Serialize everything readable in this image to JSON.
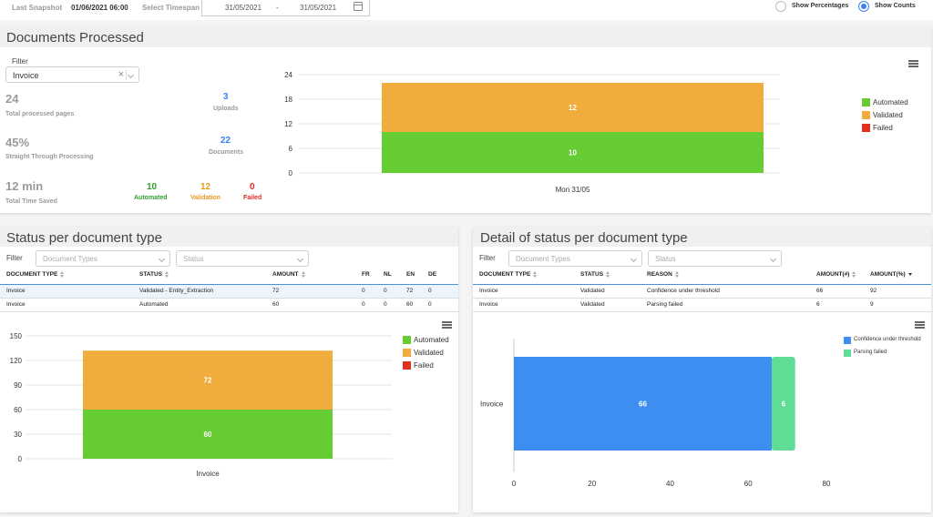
{
  "topbar": {
    "last_snapshot_label": "Last Snapshot",
    "last_snapshot_value": "01/06/2021 06:00",
    "timespan_label": "Select Timespan",
    "date_from": "31/05/2021",
    "date_sep": "-",
    "date_to": "31/05/2021",
    "show_percentages": "Show Percentages",
    "show_counts": "Show Counts",
    "selected_mode": "Show Counts"
  },
  "documents_processed": {
    "title": "Documents Processed",
    "filter_label": "Filter",
    "filter_value": "Invoice",
    "total_pages_value": "24",
    "total_pages_label": "Total processed pages",
    "uploads_value": "3",
    "uploads_label": "Uploads",
    "stp_value": "45%",
    "stp_label": "Straight Through Processing",
    "documents_value": "22",
    "documents_label": "Documents",
    "time_saved_value": "12 min",
    "time_saved_label": "Total Time Saved",
    "automated_value": "10",
    "automated_label": "Automated",
    "validation_value": "12",
    "validation_label": "Validation",
    "failed_value": "0",
    "failed_label": "Failed",
    "legend": [
      "Automated",
      "Validated",
      "Failed"
    ]
  },
  "status_per_type": {
    "title": "Status per document type",
    "filter_label": "Filter",
    "doc_types_placeholder": "Document Types",
    "status_placeholder": "Status",
    "columns": [
      "DOCUMENT TYPE",
      "STATUS",
      "AMOUNT",
      "FR",
      "NL",
      "EN",
      "DE"
    ],
    "rows": [
      [
        "Invoice",
        "Validated - Entity_Extraction",
        "72",
        "0",
        "0",
        "72",
        "0"
      ],
      [
        "Invoice",
        "Automated",
        "60",
        "0",
        "0",
        "60",
        "0"
      ]
    ],
    "legend": [
      "Automated",
      "Validated",
      "Failed"
    ]
  },
  "detail_status": {
    "title": "Detail of status per document type",
    "filter_label": "Filter",
    "doc_types_placeholder": "Document Types",
    "status_placeholder": "Status",
    "columns": [
      "DOCUMENT TYPE",
      "STATUS",
      "REASON",
      "AMOUNT(#)",
      "AMOUNT(%)"
    ],
    "rows": [
      [
        "Invoice",
        "Validated",
        "Confidence under threshold",
        "66",
        "92"
      ],
      [
        "Invoice",
        "Validated",
        "Parsing failed",
        "6",
        "9"
      ]
    ],
    "legend": [
      "Confidence under threshold",
      "Parsing failed"
    ]
  },
  "colors": {
    "automated": "#66cc33",
    "validated": "#f0ad3e",
    "failed": "#e0301e",
    "confidence": "#3d8ef0",
    "parsing_failed": "#5fdc96",
    "accent": "#3b82f6"
  },
  "chart_data": [
    {
      "type": "bar",
      "stacked": true,
      "categories": [
        "Mon 31/05"
      ],
      "series": [
        {
          "name": "Automated",
          "values": [
            10
          ]
        },
        {
          "name": "Validated",
          "values": [
            12
          ]
        },
        {
          "name": "Failed",
          "values": [
            0
          ]
        }
      ],
      "ylim": [
        0,
        24
      ],
      "yticks": [
        0,
        6,
        12,
        18,
        24
      ],
      "legend_position": "right",
      "grid": true
    },
    {
      "type": "bar",
      "stacked": true,
      "categories": [
        "Invoice"
      ],
      "series": [
        {
          "name": "Automated",
          "values": [
            60
          ]
        },
        {
          "name": "Validated",
          "values": [
            72
          ]
        },
        {
          "name": "Failed",
          "values": [
            0
          ]
        }
      ],
      "ylim": [
        0,
        150
      ],
      "yticks": [
        0,
        30,
        60,
        90,
        120,
        150
      ],
      "legend_position": "right",
      "grid": true
    },
    {
      "type": "bar",
      "orientation": "horizontal",
      "stacked": true,
      "categories": [
        "Invoice"
      ],
      "series": [
        {
          "name": "Confidence under threshold",
          "values": [
            66
          ]
        },
        {
          "name": "Parsing failed",
          "values": [
            6
          ]
        }
      ],
      "xlim": [
        0,
        80
      ],
      "xticks": [
        0,
        20,
        40,
        60,
        80
      ],
      "legend_position": "top-right",
      "grid": false
    }
  ]
}
